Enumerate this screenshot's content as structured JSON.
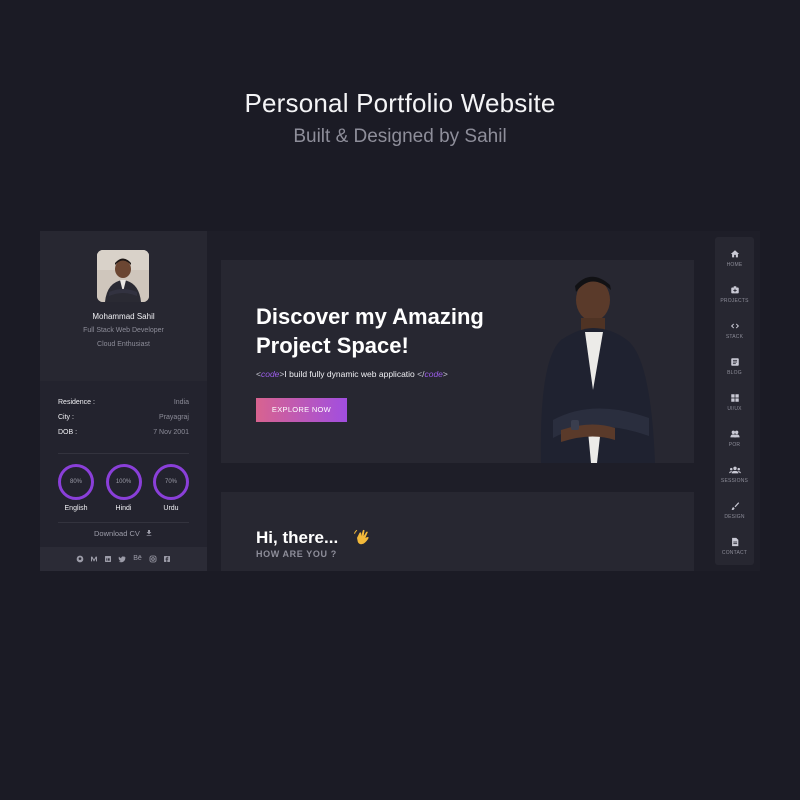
{
  "header": {
    "title": "Personal Portfolio Website",
    "subtitle": "Built & Designed by Sahil"
  },
  "profile": {
    "name": "Mohammad Sahil",
    "role1": "Full Stack Web Developer",
    "role2": "Cloud Enthusiast",
    "info": [
      {
        "key": "Residence :",
        "value": "India"
      },
      {
        "key": "City :",
        "value": "Prayagraj"
      },
      {
        "key": "DOB :",
        "value": "7 Nov 2001"
      }
    ],
    "languages": [
      {
        "name": "English",
        "percent": "80%"
      },
      {
        "name": "Hindi",
        "percent": "100%"
      },
      {
        "name": "Urdu",
        "percent": "70%"
      }
    ],
    "download_label": "Download CV",
    "socials": [
      "github-icon",
      "medium-icon",
      "linkedin-icon",
      "twitter-icon",
      "behance-icon",
      "instagram-icon",
      "facebook-icon"
    ],
    "behance_text": "Bē"
  },
  "hero": {
    "title_line1": "Discover my Amazing",
    "title_line2": "Project Space!",
    "code_open": "<",
    "code_kw1": "code",
    "code_close1": ">",
    "code_text": "I build fully dynamic web applicatio ",
    "code_open2": "</",
    "code_kw2": "code",
    "code_close2": ">",
    "button_label": "EXPLORE NOW"
  },
  "hello": {
    "title": "Hi, there...",
    "subtitle": "HOW ARE YOU ?"
  },
  "nav": {
    "items": [
      {
        "label": "HOME",
        "icon": "home-icon"
      },
      {
        "label": "PROJECTS",
        "icon": "projects-icon"
      },
      {
        "label": "STACK",
        "icon": "code-icon"
      },
      {
        "label": "BLOG",
        "icon": "blog-icon"
      },
      {
        "label": "UI/UX",
        "icon": "dashboard-icon"
      },
      {
        "label": "POR",
        "icon": "people-icon"
      },
      {
        "label": "SESSIONS",
        "icon": "groups-icon"
      },
      {
        "label": "DESIGN",
        "icon": "brush-icon"
      },
      {
        "label": "CONTACT",
        "icon": "document-icon"
      }
    ]
  },
  "colors": {
    "background": "#1b1b25",
    "panel": "#272731",
    "accent": "#8a3fd9",
    "button_gradient_start": "#d8638f",
    "button_gradient_end": "#a14ee0"
  }
}
